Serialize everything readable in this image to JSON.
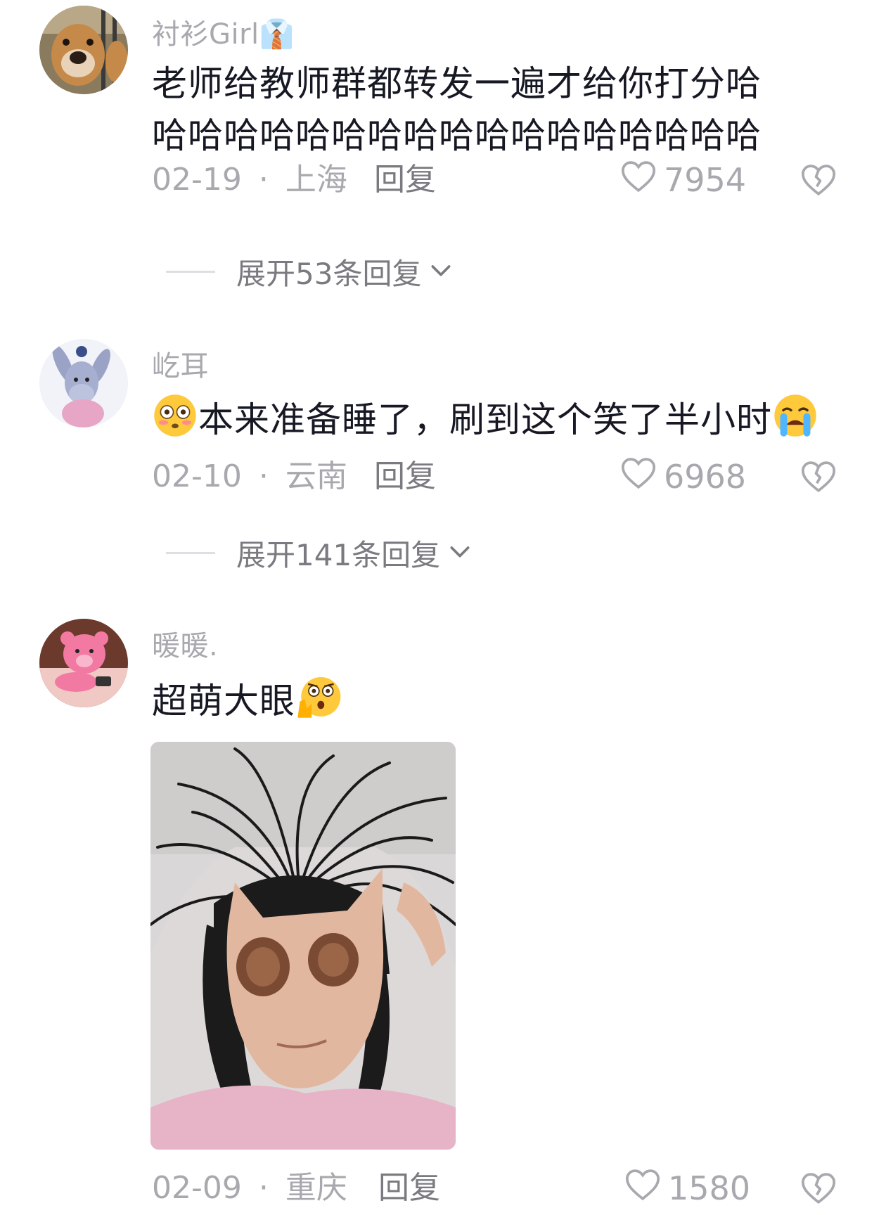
{
  "comments": [
    {
      "username": "衬衫Girl👔",
      "text": "老师给教师群都转发一遍才给你打分哈哈哈哈哈哈哈哈哈哈哈哈哈哈哈哈哈哈",
      "date": "02-19",
      "location": "上海",
      "reply_label": "回复",
      "likes": "7954",
      "expand_label": "展开53条回复",
      "avatar_icon": "dog-avatar",
      "emoji_prefix": "",
      "emoji_suffix": ""
    },
    {
      "username": "屹耳",
      "text": "本来准备睡了，刷到这个笑了半小时",
      "date": "02-10",
      "location": "云南",
      "reply_label": "回复",
      "likes": "6968",
      "expand_label": "展开141条回复",
      "avatar_icon": "eeyore-avatar",
      "emoji_prefix": "flushed-face-emoji",
      "emoji_suffix": "crying-face-emoji"
    },
    {
      "username": "暖暖.",
      "text": "超萌大眼",
      "date": "02-09",
      "location": "重庆",
      "reply_label": "回复",
      "likes": "1580",
      "avatar_icon": "pink-bear-avatar",
      "emoji_suffix": "shocked-hand-emoji",
      "image_icon": "meme-photo"
    }
  ],
  "separator": "·",
  "colors": {
    "muted": "#a8a9ae",
    "text": "#161823",
    "reply": "#7a7b80"
  }
}
